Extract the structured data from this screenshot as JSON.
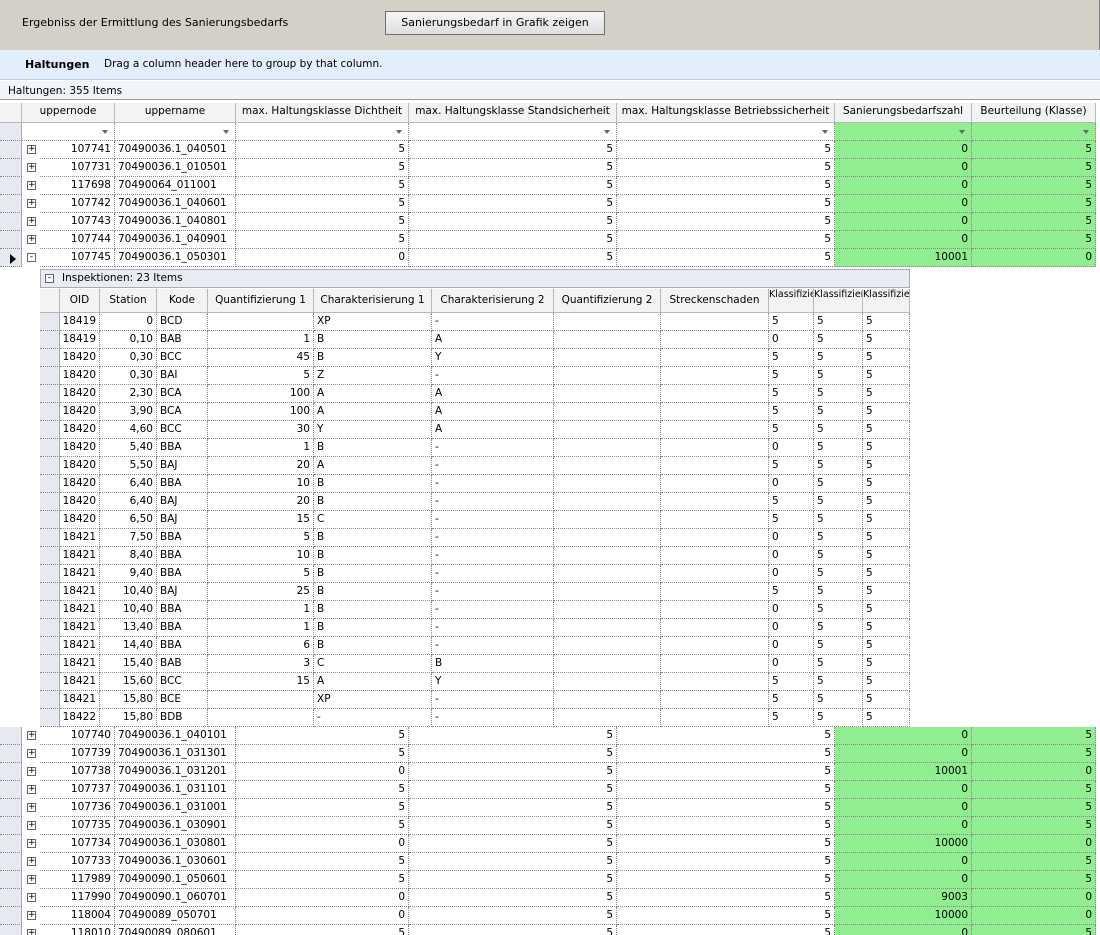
{
  "toolbar": {
    "title": "Ergebniss der Ermittlung des Sanierungsbedarfs",
    "button_label": "Sanierungsbedarf in Grafik zeigen"
  },
  "grid": {
    "title": "Haltungen",
    "group_hint": "Drag a column header here to group by that column.",
    "caption": "Haltungen: 355 Items",
    "columns": [
      "uppernode",
      "uppername",
      "max. Haltungsklasse Dichtheit",
      "max. Haltungsklasse Standsicherheit",
      "max. Haltungsklasse Betriebssicherheit",
      "Sanierungsbedarfszahl",
      "Beurteilung (Klasse)"
    ],
    "rows_before": [
      [
        "107741",
        "70490036.1_040501",
        "5",
        "5",
        "5",
        "0",
        "5"
      ],
      [
        "107731",
        "70490036.1_010501",
        "5",
        "5",
        "5",
        "0",
        "5"
      ],
      [
        "117698",
        "70490064_011001",
        "5",
        "5",
        "5",
        "0",
        "5"
      ],
      [
        "107742",
        "70490036.1_040601",
        "5",
        "5",
        "5",
        "0",
        "5"
      ],
      [
        "107743",
        "70490036.1_040801",
        "5",
        "5",
        "5",
        "0",
        "5"
      ],
      [
        "107744",
        "70490036.1_040901",
        "5",
        "5",
        "5",
        "0",
        "5"
      ],
      [
        "107745",
        "70490036.1_050301",
        "0",
        "5",
        "5",
        "10001",
        "0"
      ]
    ],
    "expand_symbol": "+",
    "collapse_symbol": "-",
    "rows_after": [
      [
        "107740",
        "70490036.1_040101",
        "5",
        "5",
        "5",
        "0",
        "5"
      ],
      [
        "107739",
        "70490036.1_031301",
        "5",
        "5",
        "5",
        "0",
        "5"
      ],
      [
        "107738",
        "70490036.1_031201",
        "0",
        "5",
        "5",
        "10001",
        "0"
      ],
      [
        "107737",
        "70490036.1_031101",
        "5",
        "5",
        "5",
        "0",
        "5"
      ],
      [
        "107736",
        "70490036.1_031001",
        "5",
        "5",
        "5",
        "0",
        "5"
      ],
      [
        "107735",
        "70490036.1_030901",
        "5",
        "5",
        "5",
        "0",
        "5"
      ],
      [
        "107734",
        "70490036.1_030801",
        "0",
        "5",
        "5",
        "10000",
        "0"
      ],
      [
        "107733",
        "70490036.1_030601",
        "5",
        "5",
        "5",
        "0",
        "5"
      ],
      [
        "117989",
        "70490090.1_050601",
        "5",
        "5",
        "5",
        "0",
        "5"
      ],
      [
        "117990",
        "70490090.1_060701",
        "0",
        "5",
        "5",
        "9003",
        "0"
      ],
      [
        "118004",
        "70490089_050701",
        "0",
        "5",
        "5",
        "10000",
        "0"
      ],
      [
        "118010",
        "70490089_080601",
        "5",
        "5",
        "5",
        "0",
        "5"
      ]
    ]
  },
  "subgrid": {
    "caption": "Inspektionen: 23 Items",
    "columns": [
      "OID",
      "Station",
      "Kode",
      "Quantifizierung 1",
      "Charakterisierung 1",
      "Charakterisierung 2",
      "Quantifizierung 2",
      "Streckenschaden",
      "Klassifizierung",
      "Klassifizierung",
      "Klassifizierung"
    ],
    "rows": [
      [
        "18419",
        "0",
        "BCD",
        "",
        "XP",
        "-",
        "",
        "",
        "5",
        "5",
        "5"
      ],
      [
        "18419",
        "0,10",
        "BAB",
        "1",
        "B",
        "A",
        "",
        "",
        "0",
        "5",
        "5"
      ],
      [
        "18420",
        "0,30",
        "BCC",
        "45",
        "B",
        "Y",
        "",
        "",
        "5",
        "5",
        "5"
      ],
      [
        "18420",
        "0,30",
        "BAI",
        "5",
        "Z",
        "-",
        "",
        "",
        "5",
        "5",
        "5"
      ],
      [
        "18420",
        "2,30",
        "BCA",
        "100",
        "A",
        "A",
        "",
        "",
        "5",
        "5",
        "5"
      ],
      [
        "18420",
        "3,90",
        "BCA",
        "100",
        "A",
        "A",
        "",
        "",
        "5",
        "5",
        "5"
      ],
      [
        "18420",
        "4,60",
        "BCC",
        "30",
        "Y",
        "A",
        "",
        "",
        "5",
        "5",
        "5"
      ],
      [
        "18420",
        "5,40",
        "BBA",
        "1",
        "B",
        "-",
        "",
        "",
        "0",
        "5",
        "5"
      ],
      [
        "18420",
        "5,50",
        "BAJ",
        "20",
        "A",
        "-",
        "",
        "",
        "5",
        "5",
        "5"
      ],
      [
        "18420",
        "6,40",
        "BBA",
        "10",
        "B",
        "-",
        "",
        "",
        "0",
        "5",
        "5"
      ],
      [
        "18420",
        "6,40",
        "BAJ",
        "20",
        "B",
        "-",
        "",
        "",
        "5",
        "5",
        "5"
      ],
      [
        "18420",
        "6,50",
        "BAJ",
        "15",
        "C",
        "-",
        "",
        "",
        "5",
        "5",
        "5"
      ],
      [
        "18421",
        "7,50",
        "BBA",
        "5",
        "B",
        "-",
        "",
        "",
        "0",
        "5",
        "5"
      ],
      [
        "18421",
        "8,40",
        "BBA",
        "10",
        "B",
        "-",
        "",
        "",
        "0",
        "5",
        "5"
      ],
      [
        "18421",
        "9,40",
        "BBA",
        "5",
        "B",
        "-",
        "",
        "",
        "0",
        "5",
        "5"
      ],
      [
        "18421",
        "10,40",
        "BAJ",
        "25",
        "B",
        "-",
        "",
        "",
        "5",
        "5",
        "5"
      ],
      [
        "18421",
        "10,40",
        "BBA",
        "1",
        "B",
        "-",
        "",
        "",
        "0",
        "5",
        "5"
      ],
      [
        "18421",
        "13,40",
        "BBA",
        "1",
        "B",
        "-",
        "",
        "",
        "0",
        "5",
        "5"
      ],
      [
        "18421",
        "14,40",
        "BBA",
        "6",
        "B",
        "-",
        "",
        "",
        "0",
        "5",
        "5"
      ],
      [
        "18421",
        "15,40",
        "BAB",
        "3",
        "C",
        "B",
        "",
        "",
        "0",
        "5",
        "5"
      ],
      [
        "18421",
        "15,60",
        "BCC",
        "15",
        "A",
        "Y",
        "",
        "",
        "5",
        "5",
        "5"
      ],
      [
        "18421",
        "15,80",
        "BCE",
        "",
        "XP",
        "-",
        "",
        "",
        "5",
        "5",
        "5"
      ],
      [
        "18422",
        "15,80",
        "BDB",
        "",
        "-",
        "-",
        "",
        "",
        "5",
        "5",
        "5"
      ]
    ]
  },
  "colors": {
    "highlight": "#90ee90",
    "toolbar": "#d4d0c8",
    "group_panel": "#e3eefc"
  }
}
